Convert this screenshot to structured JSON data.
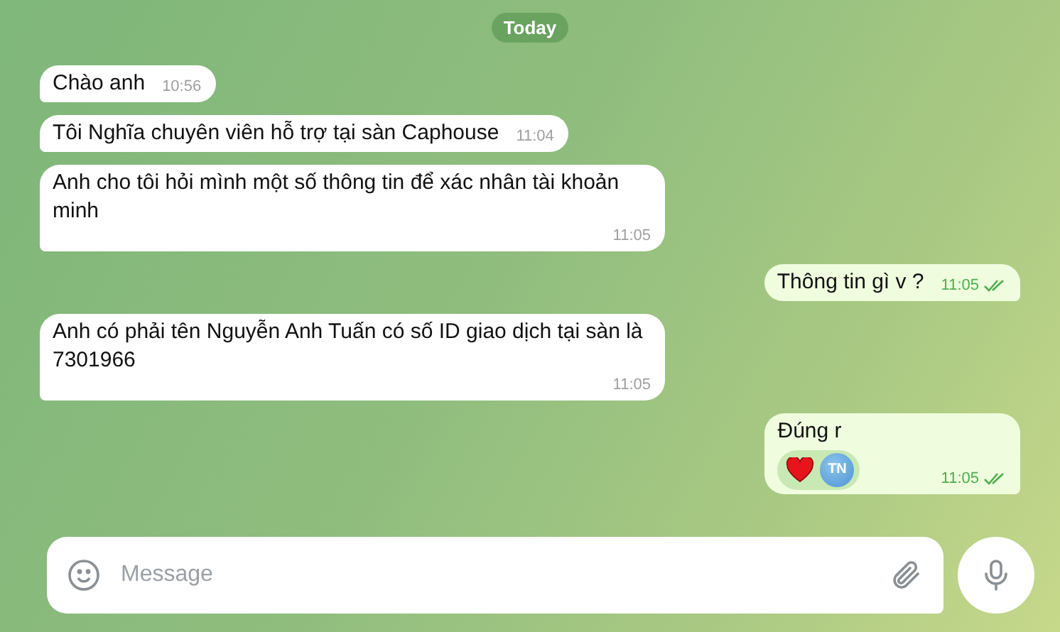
{
  "date_pill": "Today",
  "messages": [
    {
      "kind": "incoming",
      "text": "Chào anh",
      "time": "10:56"
    },
    {
      "kind": "incoming",
      "text": "Tôi Nghĩa chuyên viên hỗ trợ tại sàn Caphouse",
      "time": "11:04"
    },
    {
      "kind": "incoming",
      "text": "Anh cho tôi hỏi mình một số thông tin để xác nhân tài khoản minh",
      "time": "11:05"
    },
    {
      "kind": "outgoing",
      "text": "Thông tin gì v ?",
      "time": "11:05",
      "read": true
    },
    {
      "kind": "incoming",
      "text": "Anh có phải tên Nguyễn Anh Tuấn có số ID giao dịch tại sàn là 7301966",
      "time": "11:05"
    },
    {
      "kind": "outgoing",
      "text": "Đúng r",
      "time": "11:05",
      "read": true,
      "reaction": {
        "user_initials": "TN"
      }
    }
  ],
  "composer": {
    "placeholder": "Message"
  }
}
